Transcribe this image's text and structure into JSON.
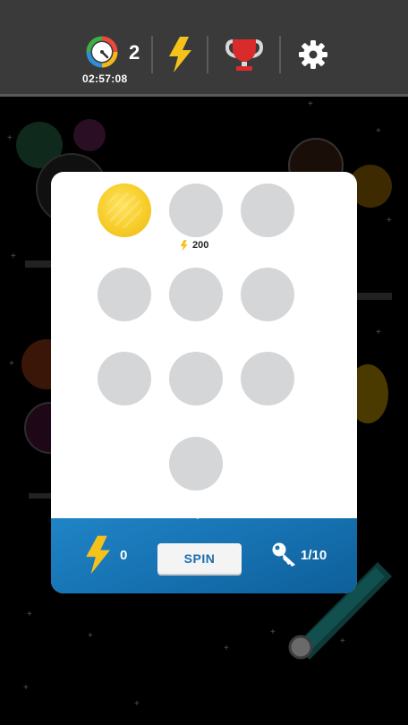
{
  "topbar": {
    "timer_count": "2",
    "timer_text": "02:57:08",
    "icons": [
      "stopwatch-icon",
      "lightning-icon",
      "trophy-icon",
      "gear-icon"
    ]
  },
  "wheel": {
    "slots": [
      {
        "state": "gold",
        "reward": ""
      },
      {
        "state": "empty",
        "reward": "200"
      },
      {
        "state": "empty",
        "reward": ""
      },
      {
        "state": "empty",
        "reward": ""
      },
      {
        "state": "empty",
        "reward": ""
      },
      {
        "state": "empty",
        "reward": ""
      },
      {
        "state": "empty",
        "reward": ""
      },
      {
        "state": "empty",
        "reward": ""
      },
      {
        "state": "empty",
        "reward": ""
      },
      {
        "state": "empty",
        "reward": ""
      }
    ]
  },
  "footer": {
    "energy_count": "0",
    "spin_label": "SPIN",
    "keys_count": "1/10"
  },
  "colors": {
    "topbar": "#3a3a3a",
    "gold": "#f7cd2a",
    "slot": "#d5d6d7",
    "footer_blue": "#1874b4",
    "lightning": "#f5c21b"
  }
}
